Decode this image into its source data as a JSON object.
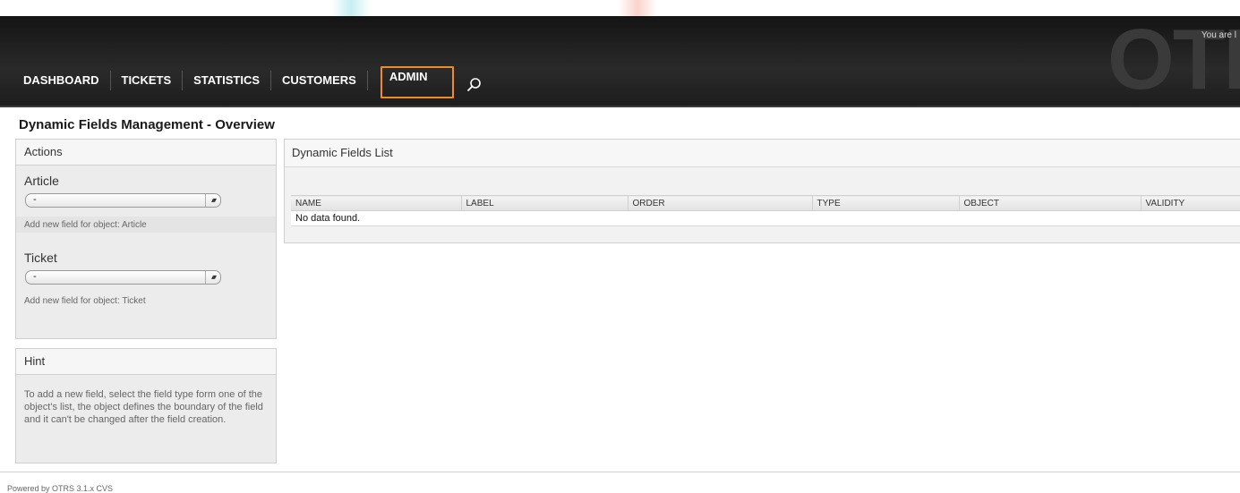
{
  "header": {
    "brand": "OTI",
    "welcome": "You are l"
  },
  "nav": {
    "items": [
      "DASHBOARD",
      "TICKETS",
      "STATISTICS",
      "CUSTOMERS",
      "ADMIN"
    ],
    "active": "ADMIN",
    "search_icon": "search-icon"
  },
  "page": {
    "title": "Dynamic Fields Management - Overview"
  },
  "actions": {
    "title": "Actions",
    "article": {
      "label": "Article",
      "select_value": "-",
      "help": "Add new field for object: Article"
    },
    "ticket": {
      "label": "Ticket",
      "select_value": "-",
      "help": "Add new field for object: Ticket"
    }
  },
  "hint": {
    "title": "Hint",
    "text": "To add a new field, select the field type form one of the object's list, the object defines the boundary of the field and it can't be changed after the field creation."
  },
  "list": {
    "title": "Dynamic Fields List",
    "columns": [
      "NAME",
      "LABEL",
      "ORDER",
      "TYPE",
      "OBJECT",
      "VALIDITY"
    ],
    "empty": "No data found."
  },
  "footer": {
    "text": "Powered by OTRS 3.1.x CVS"
  },
  "colors": {
    "active_border": "#f08a24",
    "header_bg": "#1d1d1d"
  }
}
